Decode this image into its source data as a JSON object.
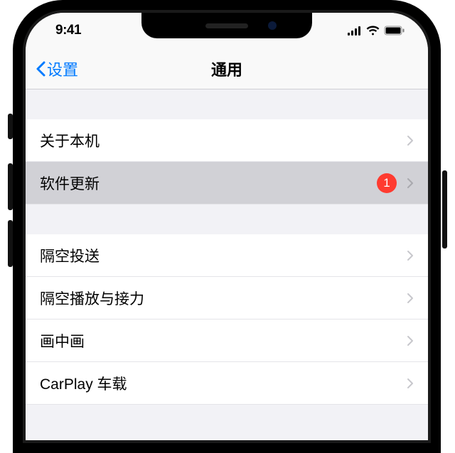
{
  "status": {
    "time": "9:41"
  },
  "nav": {
    "back_label": "设置",
    "title": "通用"
  },
  "rows": {
    "about": "关于本机",
    "software_update": "软件更新",
    "software_update_badge": "1",
    "airdrop": "隔空投送",
    "airplay": "隔空播放与接力",
    "pip": "画中画",
    "carplay": "CarPlay 车载"
  },
  "colors": {
    "accent": "#007aff",
    "badge": "#ff3b30"
  }
}
